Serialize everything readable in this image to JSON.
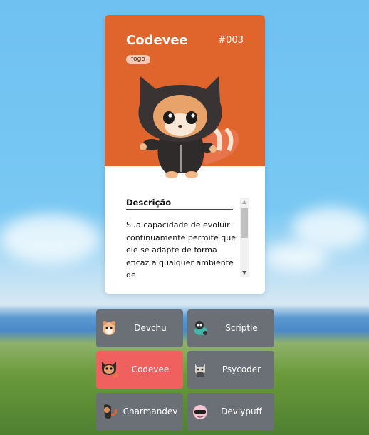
{
  "card": {
    "name": "Codevee",
    "number": "#003",
    "type": "fogo",
    "accent_color": "#e0652c",
    "image": "red-panda-creature-in-hoodie",
    "description_title": "Descrição",
    "description": "Sua capacidade de evoluir continuamente permite que ele se adapte de forma eficaz a qualquer ambiente de"
  },
  "list": {
    "tile_color": "#6b6f76",
    "active_color": "#f0605f",
    "items": [
      {
        "label": "Devchu",
        "icon": "hamster-creature-icon",
        "active": false
      },
      {
        "label": "Scriptle",
        "icon": "turtle-creature-icon",
        "active": false
      },
      {
        "label": "Codevee",
        "icon": "red-panda-creature-icon",
        "active": true
      },
      {
        "label": "Psycoder",
        "icon": "cat-creature-icon",
        "active": false
      },
      {
        "label": "Charmandev",
        "icon": "lizard-creature-icon",
        "active": false
      },
      {
        "label": "Devlypuff",
        "icon": "puffball-creature-icon",
        "active": false
      }
    ]
  }
}
